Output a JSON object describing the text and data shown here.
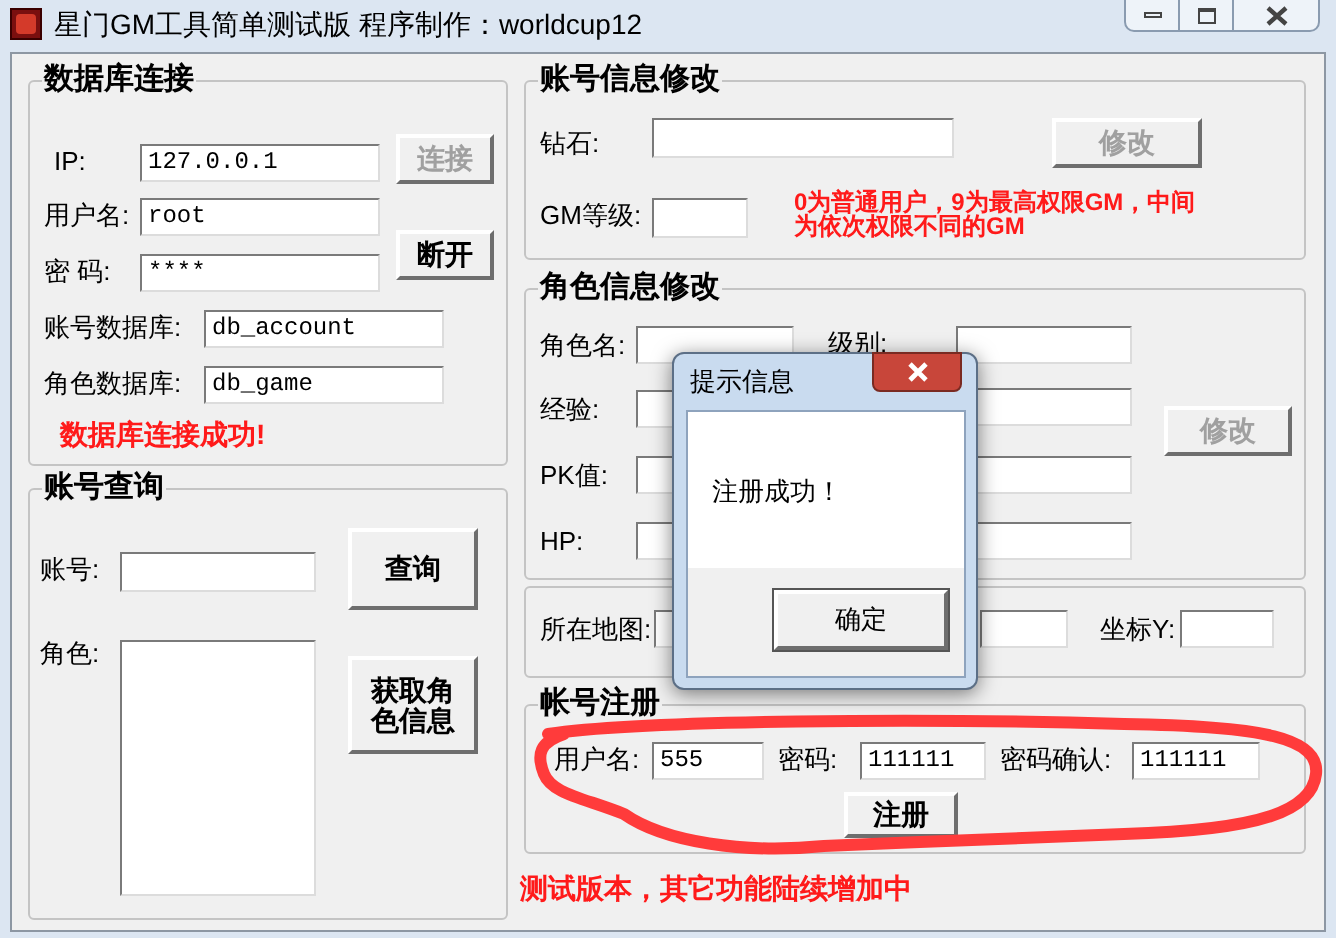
{
  "window": {
    "title": "星门GM工具简单测试版 程序制作：worldcup12"
  },
  "db_connection": {
    "title": "数据库连接",
    "fields": [
      {
        "label": "IP:",
        "value": "127.0.0.1"
      },
      {
        "label": "用户名:",
        "value": "root"
      },
      {
        "label": "密 码:",
        "value": "****"
      },
      {
        "label": "账号数据库:",
        "value": "db_account"
      },
      {
        "label": "角色数据库:",
        "value": "db_game"
      }
    ],
    "buttons": [
      {
        "label": "连接",
        "disabled": true
      },
      {
        "label": "断开",
        "disabled": false
      }
    ],
    "status": "数据库连接成功!"
  },
  "account_query": {
    "title": "账号查询",
    "account_label": "账号:",
    "role_label": "角色:",
    "buttons": [
      {
        "label": "查询",
        "disabled": false
      },
      {
        "label": "获取角色信息",
        "disabled": false
      }
    ]
  },
  "account_edit": {
    "title": "账号信息修改",
    "fields": [
      {
        "label": "钻石:"
      },
      {
        "label": "GM等级:"
      }
    ],
    "button": {
      "label": "修改",
      "disabled": true
    },
    "note": "0为普通用户，9为最高权限GM，中间为依次权限不同的GM"
  },
  "role_edit": {
    "title": "角色信息修改",
    "fields": [
      {
        "label": "角色名:"
      },
      {
        "label": "级别:"
      },
      {
        "label": "经验:"
      },
      {
        "label": "PK值:"
      },
      {
        "label": "HP:"
      }
    ],
    "button": {
      "label": "修改",
      "disabled": true
    }
  },
  "location": {
    "fields": [
      {
        "label": "所在地图:"
      },
      {
        "label": "坐标Y:"
      }
    ]
  },
  "register": {
    "title": "帐号注册",
    "fields": [
      {
        "label": "用户名:",
        "value": "555"
      },
      {
        "label": "密码:",
        "value": "111111"
      },
      {
        "label": "密码确认:",
        "value": "111111"
      }
    ],
    "button": {
      "label": "注册",
      "disabled": false
    }
  },
  "footer_note": "测试版本，其它功能陆续增加中",
  "dialog": {
    "title": "提示信息",
    "message": "注册成功！",
    "button": "确定"
  }
}
